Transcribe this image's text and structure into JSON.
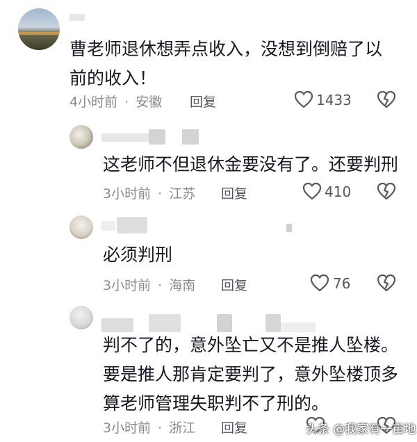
{
  "comments": [
    {
      "text_line1": "曹老师退休想弄点收入，没想到倒赔了以",
      "text_line2": "前的收入！",
      "time": "4小时前",
      "location": "安徽",
      "reply_label": "回复",
      "likes": "1433"
    },
    {
      "text_line1": "这老师不但退休金要没有了。还要判刑",
      "time": "3小时前",
      "location": "江苏",
      "reply_label": "回复",
      "likes": "410"
    },
    {
      "text_line1": "必须判刑",
      "time": "3小时前",
      "location": "海南",
      "reply_label": "回复",
      "likes": "76"
    },
    {
      "text_line1": "判不了的，意外坠亡又不是推人坠楼。",
      "text_line2": "要是推人那肯定要判了，意外坠楼顶多",
      "text_line3": "算老师管理失职判不了刑的。",
      "time": "3小时前",
      "location": "浙江",
      "reply_label": "回复"
    }
  ],
  "separator": "·",
  "watermark": "头条 @我家有一亩地",
  "colors": {
    "text": "#161823",
    "meta": "#8a8b91",
    "icon": "#555760"
  }
}
